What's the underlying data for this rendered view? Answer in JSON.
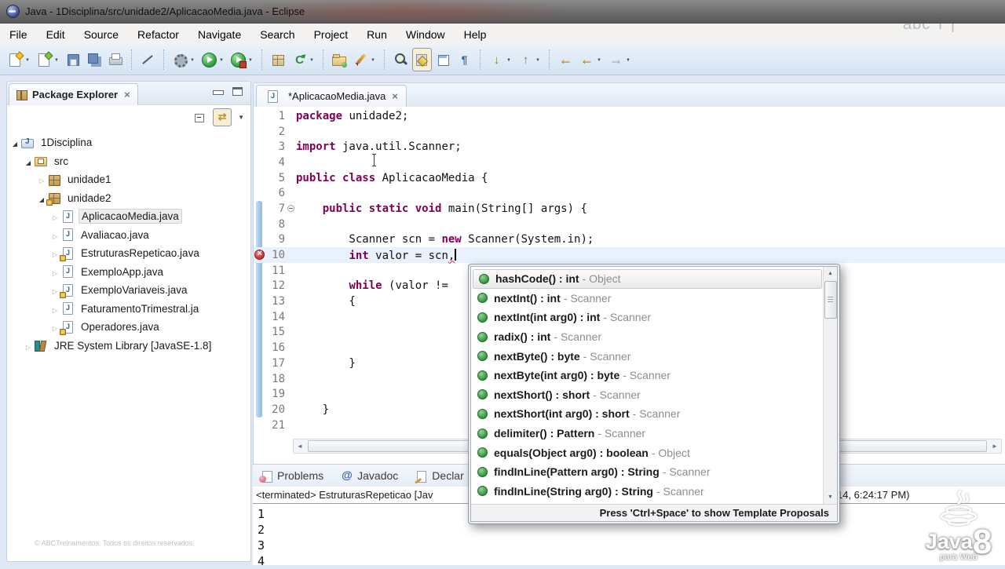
{
  "colors": {
    "keyword": "#7f0055",
    "error_red": "#c42b2b",
    "method_green": "#2f8f36",
    "toolbar_bg": "#d5e3f2",
    "current_line": "#e8f1fc"
  },
  "window": {
    "title": "Java - 1Disciplina/src/unidade2/AplicacaoMedia.java - Eclipse"
  },
  "menubar": {
    "items": [
      "File",
      "Edit",
      "Source",
      "Refactor",
      "Navigate",
      "Search",
      "Project",
      "Run",
      "Window",
      "Help"
    ]
  },
  "toolbar": {
    "buttons": [
      {
        "name": "new-wizard",
        "kind": "new",
        "dropdown": true
      },
      {
        "name": "new-java-element",
        "kind": "new2",
        "dropdown": true
      },
      {
        "name": "save",
        "kind": "save"
      },
      {
        "name": "save-all",
        "kind": "saveall"
      },
      {
        "name": "print",
        "kind": "print"
      },
      {
        "sep": true
      },
      {
        "name": "skip-all-breakpoints",
        "kind": "skip"
      },
      {
        "sep": true
      },
      {
        "name": "external-tools",
        "kind": "gear",
        "dropdown": true
      },
      {
        "name": "run",
        "kind": "run",
        "dropdown": true
      },
      {
        "name": "run-last-launched",
        "kind": "runq",
        "dropdown": true
      },
      {
        "sep": true
      },
      {
        "name": "new-java-project",
        "kind": "grid"
      },
      {
        "name": "refresh",
        "kind": "refresh",
        "glyph": "C",
        "dropdown": true
      },
      {
        "sep": true
      },
      {
        "name": "open-type",
        "kind": "folder"
      },
      {
        "name": "externalize-strings",
        "kind": "pencil",
        "dropdown": true
      },
      {
        "sep": true
      },
      {
        "name": "search",
        "kind": "search"
      },
      {
        "name": "mark-occurrences",
        "kind": "mark",
        "pressed": true
      },
      {
        "name": "show-selected-element",
        "kind": "frame"
      },
      {
        "name": "show-whitespace",
        "kind": "pilcrow",
        "glyph": "¶"
      },
      {
        "sep": true
      },
      {
        "name": "next-annotation",
        "kind": "down",
        "glyph": "↓",
        "dropdown": true
      },
      {
        "name": "previous-annotation",
        "kind": "up",
        "glyph": "↑",
        "dropdown": true
      },
      {
        "sep": true
      },
      {
        "name": "last-edit-location",
        "kind": "back",
        "glyph": "←"
      },
      {
        "name": "back-history",
        "kind": "back2",
        "glyph": "←",
        "dropdown": true
      },
      {
        "name": "forward-history",
        "kind": "fwd",
        "glyph": "→",
        "dropdown": true,
        "disabled": true
      }
    ]
  },
  "package_explorer": {
    "title": "Package Explorer",
    "tree": [
      {
        "label": "1Disciplina",
        "depth": 0,
        "icon": "project",
        "expander": "open"
      },
      {
        "label": "src",
        "depth": 1,
        "icon": "src",
        "expander": "open"
      },
      {
        "label": "unidade1",
        "depth": 2,
        "icon": "pkg",
        "expander": "closed"
      },
      {
        "label": "unidade2",
        "depth": 2,
        "icon": "pkg",
        "expander": "open",
        "deco": true
      },
      {
        "label": "AplicacaoMedia.java",
        "depth": 3,
        "icon": "java",
        "expander": "closed",
        "selected": true
      },
      {
        "label": "Avaliacao.java",
        "depth": 3,
        "icon": "java",
        "expander": "closed"
      },
      {
        "label": "EstruturasRepeticao.java",
        "depth": 3,
        "icon": "java",
        "expander": "closed",
        "deco": true
      },
      {
        "label": "ExemploApp.java",
        "depth": 3,
        "icon": "java",
        "expander": "closed"
      },
      {
        "label": "ExemploVariaveis.java",
        "depth": 3,
        "icon": "java",
        "expander": "closed",
        "deco": true
      },
      {
        "label": "FaturamentoTrimestral.ja",
        "depth": 3,
        "icon": "java",
        "expander": "closed"
      },
      {
        "label": "Operadores.java",
        "depth": 3,
        "icon": "java",
        "expander": "closed",
        "deco": true
      },
      {
        "label": "JRE System Library [JavaSE-1.8]",
        "depth": 1,
        "icon": "lib",
        "expander": "closed"
      }
    ]
  },
  "editor": {
    "tab": {
      "label": "*AplicacaoMedia.java"
    },
    "current_line": 10,
    "error_line": 10,
    "fold_line": 7,
    "lines": [
      {
        "n": 1,
        "segs": [
          [
            "package",
            "k"
          ],
          [
            " unidade2;",
            ""
          ]
        ]
      },
      {
        "n": 2,
        "segs": []
      },
      {
        "n": 3,
        "segs": [
          [
            "import",
            "k"
          ],
          [
            " java.util.Scanner;",
            ""
          ]
        ]
      },
      {
        "n": 4,
        "segs": []
      },
      {
        "n": 5,
        "segs": [
          [
            "public",
            "k"
          ],
          [
            " ",
            ""
          ],
          [
            "class",
            "k"
          ],
          [
            " AplicacaoMedia {",
            ""
          ]
        ]
      },
      {
        "n": 6,
        "segs": []
      },
      {
        "n": 7,
        "segs": [
          [
            "    ",
            ""
          ],
          [
            "public",
            "k"
          ],
          [
            " ",
            ""
          ],
          [
            "static",
            "k"
          ],
          [
            " ",
            ""
          ],
          [
            "void",
            "k"
          ],
          [
            " main(String[] args) {",
            ""
          ]
        ]
      },
      {
        "n": 8,
        "segs": []
      },
      {
        "n": 9,
        "segs": [
          [
            "        Scanner scn = ",
            ""
          ],
          [
            "new",
            "k"
          ],
          [
            " Scanner(System.in);",
            ""
          ]
        ]
      },
      {
        "n": 10,
        "caret": true,
        "segs": [
          [
            "        ",
            ""
          ],
          [
            "int",
            "k"
          ],
          [
            " valor = scn",
            ""
          ],
          [
            ",",
            "e"
          ]
        ]
      },
      {
        "n": 11,
        "segs": []
      },
      {
        "n": 12,
        "segs": [
          [
            "        ",
            ""
          ],
          [
            "while",
            "k"
          ],
          [
            " (valor != ",
            ""
          ]
        ]
      },
      {
        "n": 13,
        "segs": [
          [
            "        {",
            ""
          ]
        ]
      },
      {
        "n": 14,
        "segs": []
      },
      {
        "n": 15,
        "segs": []
      },
      {
        "n": 16,
        "segs": []
      },
      {
        "n": 17,
        "segs": [
          [
            "        }",
            ""
          ]
        ]
      },
      {
        "n": 18,
        "segs": []
      },
      {
        "n": 19,
        "segs": []
      },
      {
        "n": 20,
        "segs": [
          [
            "    }",
            ""
          ]
        ]
      },
      {
        "n": 21,
        "segs": []
      }
    ]
  },
  "proposals": {
    "items": [
      {
        "label": "hashCode() : int",
        "from": "Object",
        "selected": true
      },
      {
        "label": "nextInt() : int",
        "from": "Scanner"
      },
      {
        "label": "nextInt(int arg0) : int",
        "from": "Scanner"
      },
      {
        "label": "radix() : int",
        "from": "Scanner"
      },
      {
        "label": "nextByte() : byte",
        "from": "Scanner"
      },
      {
        "label": "nextByte(int arg0) : byte",
        "from": "Scanner"
      },
      {
        "label": "nextShort() : short",
        "from": "Scanner"
      },
      {
        "label": "nextShort(int arg0) : short",
        "from": "Scanner"
      },
      {
        "label": "delimiter() : Pattern",
        "from": "Scanner"
      },
      {
        "label": "equals(Object arg0) : boolean",
        "from": "Object"
      },
      {
        "label": "findInLine(Pattern arg0) : String",
        "from": "Scanner"
      },
      {
        "label": "findInLine(String arg0) : String",
        "from": "Scanner"
      }
    ],
    "footer": "Press 'Ctrl+Space' to show Template Proposals"
  },
  "bottom": {
    "tabs": [
      {
        "label": "Problems",
        "icon": "problems-icon"
      },
      {
        "label": "Javadoc",
        "icon": "javadoc-icon"
      },
      {
        "label": "Declar",
        "icon": "declaration-icon"
      }
    ],
    "console_header_left": "<terminated> EstruturasRepeticao [Jav",
    "console_header_right": "14, 6:24:17 PM)",
    "console_lines": [
      "1",
      "2",
      "3",
      "4"
    ]
  },
  "watermarks": {
    "bottom_left": "© ABCTreinamentos. Todos os direitos reservados.",
    "top_right": "abc T |",
    "java8": {
      "word": "Java",
      "digit": "8",
      "sub": "para Web"
    }
  }
}
